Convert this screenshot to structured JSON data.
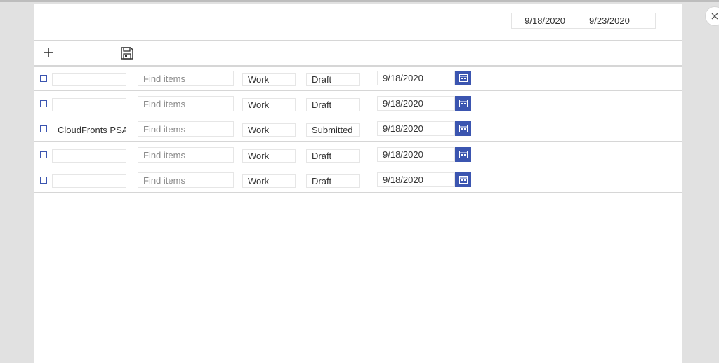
{
  "header": {
    "date_start": "9/18/2020",
    "date_end": "9/23/2020"
  },
  "toolbar": {
    "add_icon": "plus-icon",
    "save_icon": "save-icon"
  },
  "close_icon": "close-icon",
  "colors": {
    "accent": "#3b55b0",
    "border": "#d6d6d6",
    "backdrop": "#e1e1e1",
    "placeholder": "#8a8a8a"
  },
  "rows": [
    {
      "name": "",
      "project_placeholder": "Find items",
      "type": "Work",
      "status": "Draft",
      "date": "9/18/2020"
    },
    {
      "name": "",
      "project_placeholder": "Find items",
      "type": "Work",
      "status": "Draft",
      "date": "9/18/2020"
    },
    {
      "name": "CloudFronts PSA",
      "project_placeholder": "Find items",
      "type": "Work",
      "status": "Submitted",
      "date": "9/18/2020"
    },
    {
      "name": "",
      "project_placeholder": "Find items",
      "type": "Work",
      "status": "Draft",
      "date": "9/18/2020"
    },
    {
      "name": "",
      "project_placeholder": "Find items",
      "type": "Work",
      "status": "Draft",
      "date": "9/18/2020"
    }
  ]
}
